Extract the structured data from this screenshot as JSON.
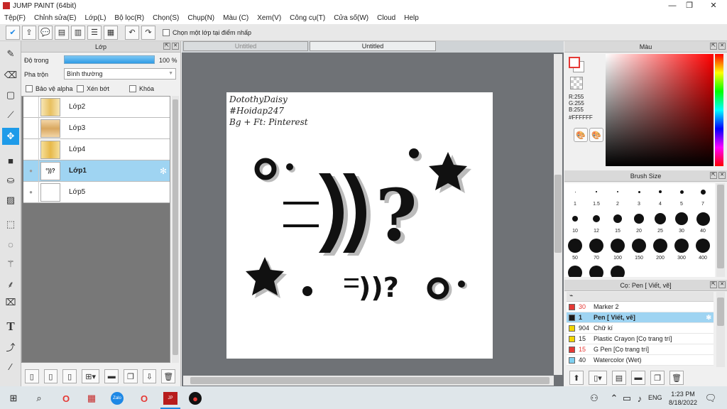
{
  "window": {
    "title": "JUMP PAINT (64bit)"
  },
  "menu": [
    "Tệp(F)",
    "Chỉnh sửa(E)",
    "Lớp(L)",
    "Bộ lọc(R)",
    "Chọn(S)",
    "Chụp(N)",
    "Màu (C)",
    "Xem(V)",
    "Công cụ(T)",
    "Cửa số(W)",
    "Cloud",
    "Help"
  ],
  "toolbar": {
    "checkbox_label": "Chọn một lớp tại điểm nhấp"
  },
  "layer_panel": {
    "title": "Lớp",
    "opacity_label": "Độ trong",
    "opacity_value": "100 %",
    "opacity_percent": 100,
    "blend_label": "Pha trộn",
    "blend_value": "Bình thường",
    "protect_alpha": "Bảo vệ alpha",
    "clip": "Xén bớt",
    "lock": "Khóa",
    "layers": [
      "Lớp2",
      "Lớp3",
      "Lớp4",
      "Lớp1",
      "Lớp5"
    ],
    "selected": "Lớp1"
  },
  "tabs": [
    "Untitled",
    "Untitled"
  ],
  "canvas_text": {
    "line1": "DotothyDaisy",
    "line2": "#Hoidap247",
    "line3": "Bg + Ft: Pinterest"
  },
  "color_panel": {
    "title": "Màu",
    "r": "R:255",
    "g": "G:255",
    "b": "B:255",
    "hex": "#FFFFFF",
    "accent": "#ff0000"
  },
  "brush_size": {
    "title": "Brush Size",
    "sizes": [
      "1",
      "1.5",
      "2",
      "3",
      "4",
      "5",
      "7",
      "10",
      "12",
      "15",
      "20",
      "25",
      "30",
      "40",
      "50",
      "70",
      "100",
      "150",
      "200",
      "300",
      "400",
      "",
      "",
      ""
    ]
  },
  "brush_list": {
    "title": "Cọ: Pen [ Viết, vẽ]",
    "items": [
      {
        "size": "30",
        "name": "Marker 2",
        "color": "#e53935"
      },
      {
        "size": "1",
        "name": "Pen [ Viết, vẽ]",
        "color": "#1a1a1a"
      },
      {
        "size": "904",
        "name": "Chữ kí",
        "color": "#f2d600"
      },
      {
        "size": "15",
        "name": "Plastic Crayon [Cọ trang trí]",
        "color": "#f2d600"
      },
      {
        "size": "15",
        "name": "G Pen [Cọ trang trí]",
        "color": "#e53935"
      },
      {
        "size": "40",
        "name": "Watercolor (Wet)",
        "color": "#7fd0f0"
      }
    ]
  },
  "taskbar": {
    "lang": "ENG",
    "time": "1:23 PM",
    "date": "8/18/2022"
  }
}
